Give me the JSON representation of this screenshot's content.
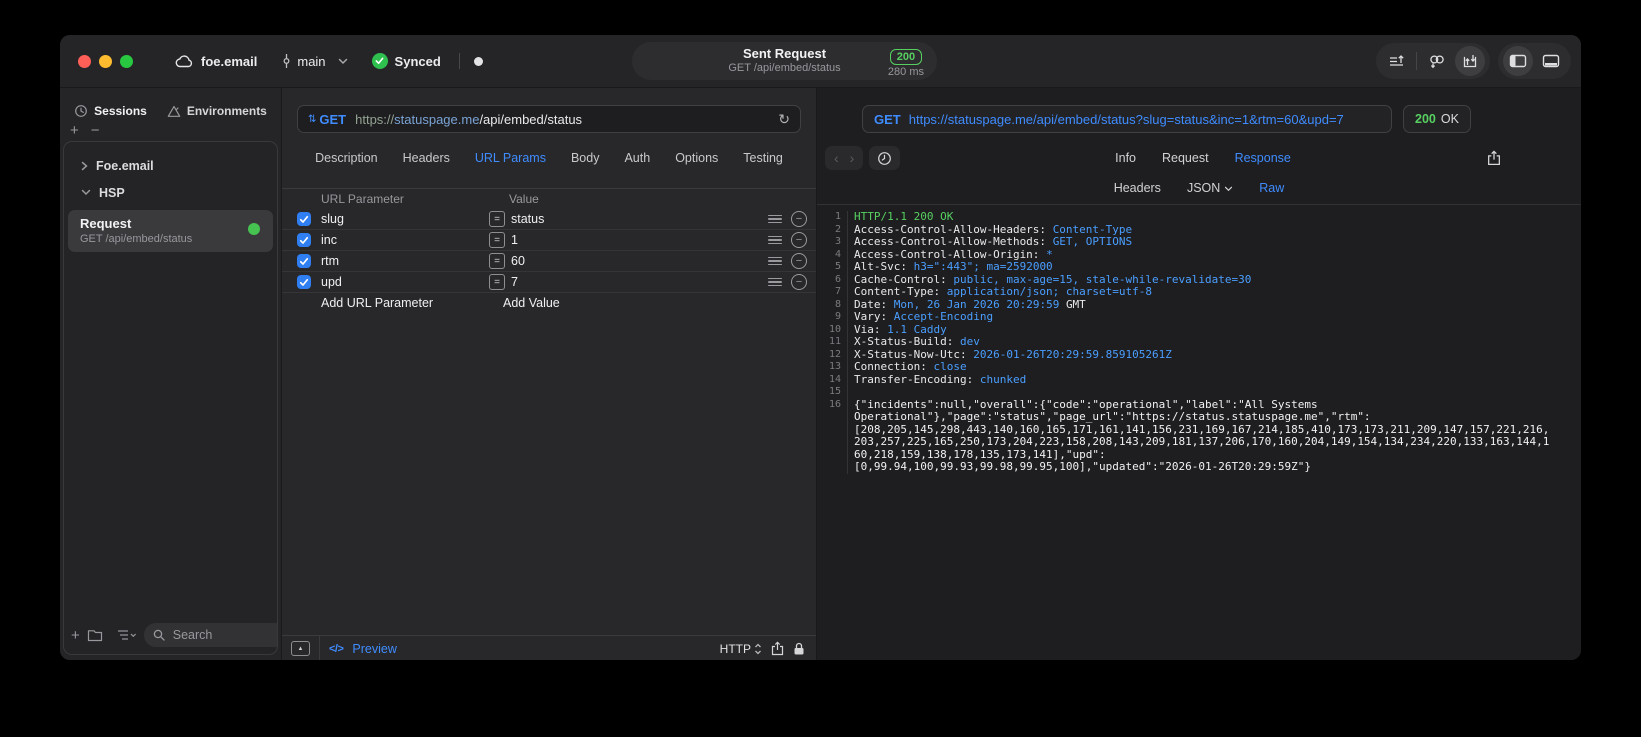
{
  "colors": {
    "accent_blue": "#3f8cff",
    "status_green": "#57d061",
    "header_value_blue": "#4a9eff",
    "checkbox_blue": "#2f7ef2"
  },
  "titlebar": {
    "project": "foe.email",
    "branch": "main",
    "sync_label": "Synced",
    "sent_request": {
      "title": "Sent Request",
      "subtitle": "GET /api/embed/status",
      "status_code": "200",
      "duration": "280 ms"
    }
  },
  "sidebar": {
    "tabs": [
      {
        "label": "Sessions",
        "icon": "history-icon"
      },
      {
        "label": "Environments",
        "icon": "environments-icon"
      }
    ],
    "tree": [
      {
        "label": "Foe.email",
        "state": "collapsed"
      },
      {
        "label": "HSP",
        "state": "expanded"
      }
    ],
    "selected_request": {
      "title": "Request",
      "subtitle": "GET /api/embed/status",
      "status_dot_color": "#45c24f"
    },
    "footer": {
      "search_placeholder": "Search"
    }
  },
  "request_editor": {
    "method": "GET",
    "url": {
      "scheme": "https://",
      "host": "statuspage.me",
      "path": "/api/embed/status"
    },
    "tabs": [
      "Description",
      "Headers",
      "URL Params",
      "Body",
      "Auth",
      "Options",
      "Testing"
    ],
    "active_tab": "URL Params",
    "params": {
      "columns": {
        "param": "URL Parameter",
        "value": "Value"
      },
      "rows": [
        {
          "enabled": true,
          "name": "slug",
          "value": "status"
        },
        {
          "enabled": true,
          "name": "inc",
          "value": "1"
        },
        {
          "enabled": true,
          "name": "rtm",
          "value": "60"
        },
        {
          "enabled": true,
          "name": "upd",
          "value": "7"
        }
      ],
      "add_param_placeholder": "Add URL Parameter",
      "add_value_placeholder": "Add Value"
    },
    "footer": {
      "code_glyph": "</>",
      "preview_label": "Preview",
      "protocol": "HTTP"
    }
  },
  "response_viewer": {
    "method": "GET",
    "url": "https://statuspage.me/api/embed/status?slug=status&inc=1&rtm=60&upd=7",
    "status_code": "200",
    "status_text": "OK",
    "tabs": [
      "Info",
      "Request",
      "Response"
    ],
    "active_tab": "Response",
    "subtabs": [
      "Headers",
      "JSON",
      "Raw"
    ],
    "active_subtab": "Raw",
    "body": {
      "lines": [
        {
          "num": "1",
          "status": "HTTP/1.1 200 OK"
        },
        {
          "num": "2",
          "name": "Access-Control-Allow-Headers: ",
          "value": "Content-Type"
        },
        {
          "num": "3",
          "name": "Access-Control-Allow-Methods: ",
          "value": "GET, OPTIONS"
        },
        {
          "num": "4",
          "name": "Access-Control-Allow-Origin: ",
          "value": "*"
        },
        {
          "num": "5",
          "name": "Alt-Svc: ",
          "value": "h3=\":443\"; ma=2592000"
        },
        {
          "num": "6",
          "name": "Cache-Control: ",
          "value": "public, max-age=15, stale-while-revalidate=30"
        },
        {
          "num": "7",
          "name": "Content-Type: ",
          "value": "application/json; charset=utf-8"
        },
        {
          "num": "8",
          "name": "Date: ",
          "value": "Mon, 26 Jan 2026 20:29:59 ",
          "extra": "GMT"
        },
        {
          "num": "9",
          "name": "Vary: ",
          "value": "Accept-Encoding"
        },
        {
          "num": "10",
          "name": "Via: ",
          "value": "1.1 Caddy"
        },
        {
          "num": "11",
          "name": "X-Status-Build: ",
          "value": "dev"
        },
        {
          "num": "12",
          "name": "X-Status-Now-Utc: ",
          "value": "2026-01-26T20:29:59.859105261Z"
        },
        {
          "num": "13",
          "name": "Connection: ",
          "value": "close"
        },
        {
          "num": "14",
          "name": "Transfer-Encoding: ",
          "value": "chunked"
        },
        {
          "num": "15"
        },
        {
          "num": "16",
          "json": [
            "{\"incidents\":null,\"overall\":{\"code\":\"operational\",\"label\":\"All Systems",
            "Operational\"},\"page\":\"status\",\"page_url\":\"https://status.statuspage.me\",\"rtm\":",
            "[208,205,145,298,443,140,160,165,171,161,141,156,231,169,167,214,185,410,173,173,211,209,147,157,221,216,",
            "203,257,225,165,250,173,204,223,158,208,143,209,181,137,206,170,160,204,149,154,134,234,220,133,163,144,1",
            "60,218,159,138,178,135,173,141],\"upd\":",
            "[0,99.94,100,99.93,99.98,99.95,100],\"updated\":\"2026-01-26T20:29:59Z\"}"
          ]
        }
      ]
    }
  }
}
